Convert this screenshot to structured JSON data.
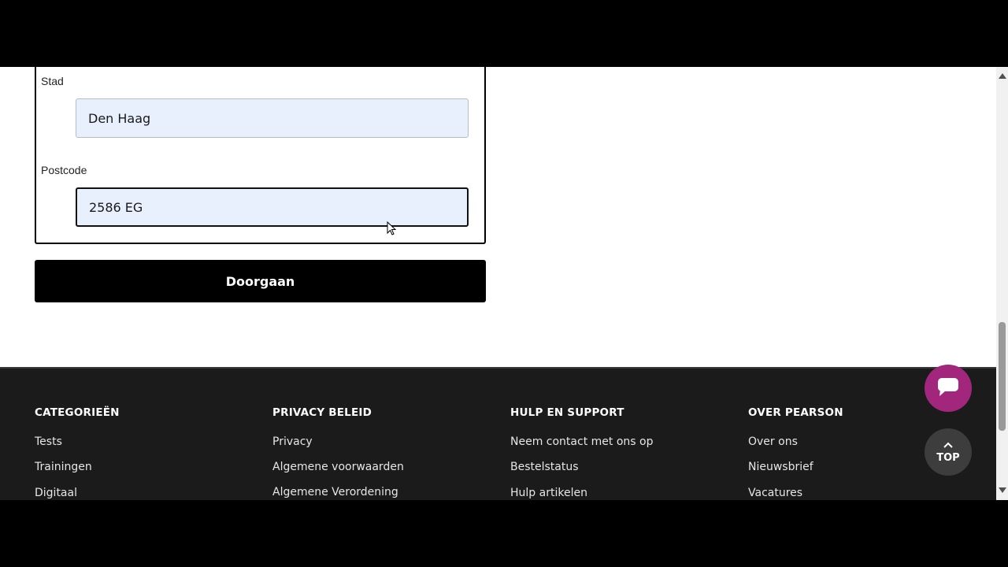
{
  "form": {
    "city_label": "Stad",
    "city_value": "Den Haag",
    "postcode_label": "Postcode",
    "postcode_value": "2586 EG",
    "continue_label": "Doorgaan"
  },
  "footer": {
    "columns": [
      {
        "title": "CATEGORIEËN",
        "links": [
          "Tests",
          "Trainingen",
          "Digitaal"
        ]
      },
      {
        "title": "PRIVACY BELEID",
        "links": [
          "Privacy",
          "Algemene voorwaarden",
          "Algemene Verordening"
        ]
      },
      {
        "title": "HULP EN SUPPORT",
        "links": [
          "Neem contact met ons op",
          "Bestelstatus",
          "Hulp artikelen"
        ]
      },
      {
        "title": "OVER PEARSON",
        "links": [
          "Over ons",
          "Nieuwsbrief",
          "Vacatures"
        ]
      }
    ]
  },
  "floating": {
    "chat_icon": "chat-bubble-icon",
    "top_label": "TOP",
    "top_icon": "chevron-up-icon",
    "chat_color": "#a3267d"
  }
}
